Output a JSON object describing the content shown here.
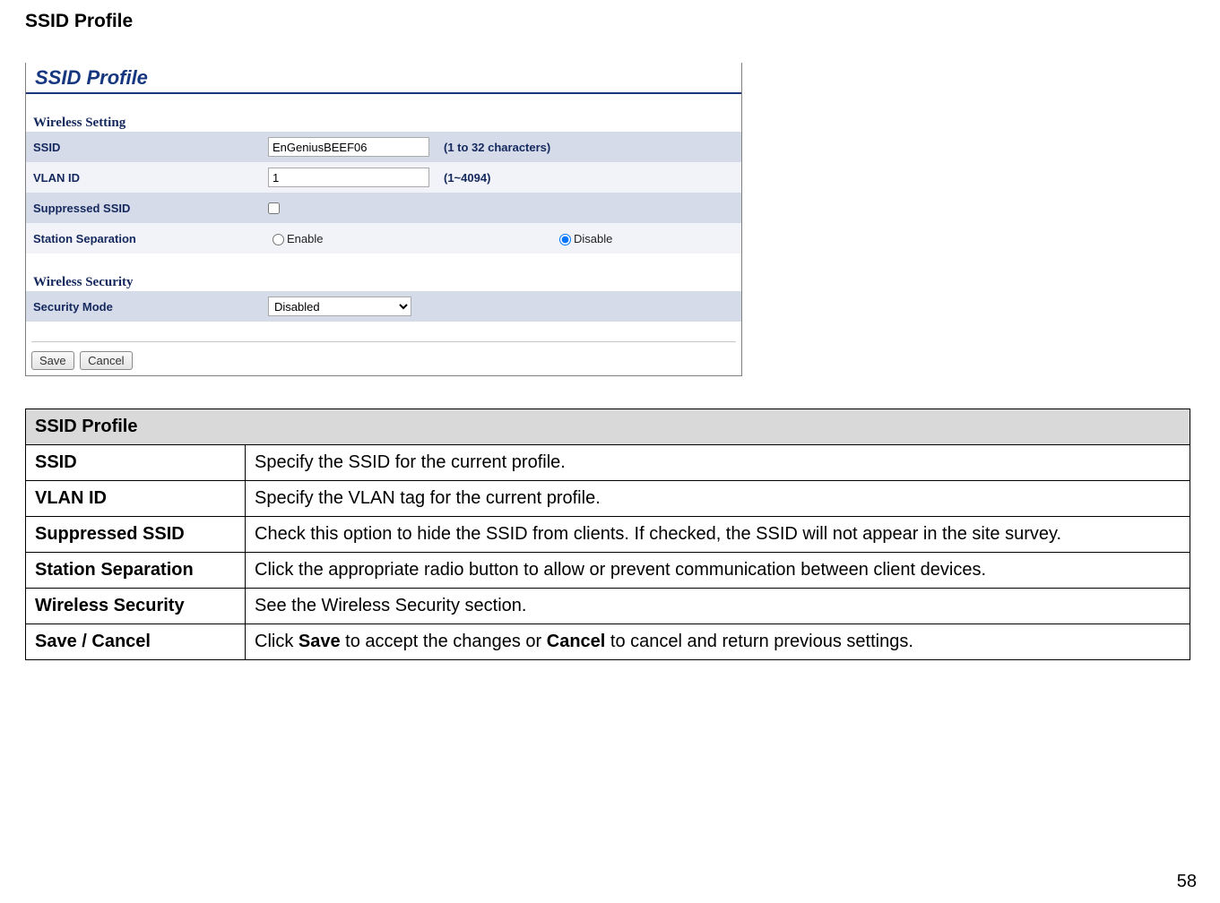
{
  "doc_heading": "SSID Profile",
  "panel": {
    "title": "SSID Profile",
    "wireless_setting_heading": "Wireless Setting",
    "wireless_security_heading": "Wireless Security",
    "rows": {
      "ssid_label": "SSID",
      "ssid_value": "EnGeniusBEEF06",
      "ssid_hint": "(1 to 32 characters)",
      "vlan_label": "VLAN ID",
      "vlan_value": "1",
      "vlan_hint": "(1~4094)",
      "suppressed_label": "Suppressed SSID",
      "separation_label": "Station Separation",
      "separation_enable": "Enable",
      "separation_disable": "Disable",
      "security_mode_label": "Security Mode",
      "security_mode_value": "Disabled"
    },
    "buttons": {
      "save": "Save",
      "cancel": "Cancel"
    }
  },
  "desc_table": {
    "header": "SSID Profile",
    "rows": [
      {
        "k": "SSID",
        "v_parts": [
          [
            "",
            "Specify the SSID for the current profile."
          ]
        ]
      },
      {
        "k": "VLAN ID",
        "v_parts": [
          [
            "",
            "Specify the VLAN tag for the current profile."
          ]
        ]
      },
      {
        "k": "Suppressed SSID",
        "v_parts": [
          [
            "",
            "Check this option to hide the SSID from clients. If checked, the SSID will not appear in the site survey."
          ]
        ]
      },
      {
        "k": "Station Separation",
        "v_parts": [
          [
            "",
            "Click the appropriate radio button to allow or prevent communication between client devices."
          ]
        ]
      },
      {
        "k": "Wireless Security",
        "v_parts": [
          [
            "",
            "See the Wireless Security section."
          ]
        ]
      },
      {
        "k": "Save / Cancel",
        "v_parts": [
          [
            "",
            "Click "
          ],
          [
            "b",
            "Save"
          ],
          [
            "",
            " to accept the changes or "
          ],
          [
            "b",
            "Cancel"
          ],
          [
            "",
            " to cancel and return previous settings."
          ]
        ]
      }
    ]
  },
  "page_number": "58"
}
